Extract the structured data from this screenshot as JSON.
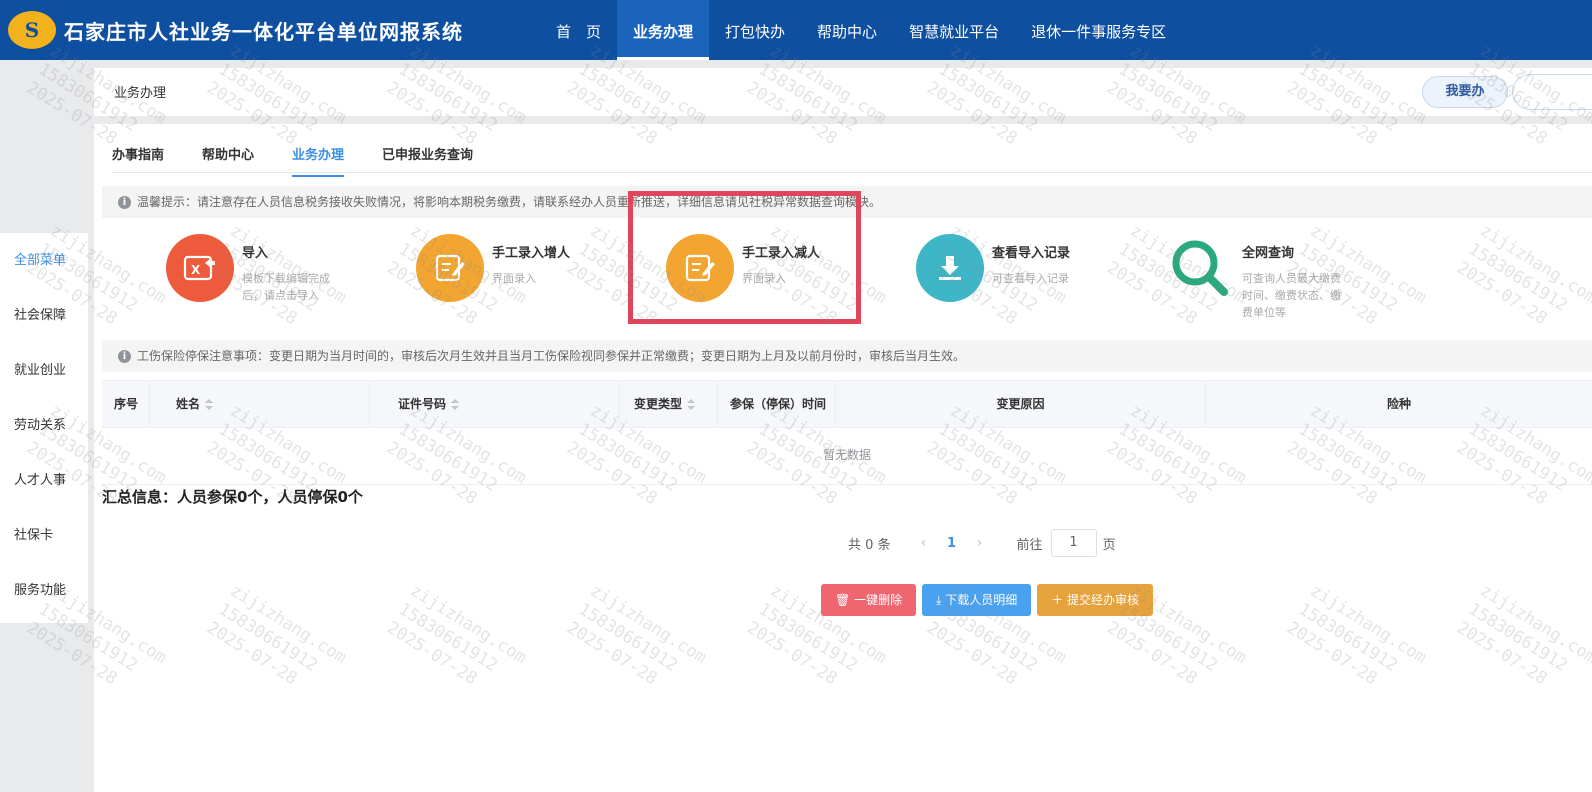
{
  "header": {
    "logo_text": "S",
    "title": "石家庄市人社业务一体化平台单位网报系统",
    "nav": [
      {
        "label": "首　页"
      },
      {
        "label": "业务办理"
      },
      {
        "label": "打包快办"
      },
      {
        "label": "帮助中心"
      },
      {
        "label": "智慧就业平台"
      },
      {
        "label": "退休一件事服务专区"
      }
    ]
  },
  "sidebar": {
    "items": [
      {
        "label": "全部菜单"
      },
      {
        "label": "社会保障"
      },
      {
        "label": "就业创业"
      },
      {
        "label": "劳动关系"
      },
      {
        "label": "人才人事"
      },
      {
        "label": "社保卡"
      },
      {
        "label": "服务功能"
      }
    ]
  },
  "breadcrumb": {
    "label": "业务办理",
    "action_label": "我要办"
  },
  "tabs": [
    {
      "label": "办事指南"
    },
    {
      "label": "帮助中心"
    },
    {
      "label": "业务办理"
    },
    {
      "label": "已申报业务查询"
    }
  ],
  "notice1": "温馨提示：请注意存在人员信息税务接收失败情况，将影响本期税务缴费，请联系经办人员重新推送，详细信息请见社税异常数据查询模块。",
  "functions": [
    {
      "title": "导入",
      "desc": "模板下载编辑完成后，请点击导入",
      "color": "#ee5a3c"
    },
    {
      "title": "手工录入增人",
      "desc": "界面录入",
      "color": "#f3a531"
    },
    {
      "title": "手工录入减人",
      "desc": "界面录入",
      "color": "#f3a531"
    },
    {
      "title": "查看导入记录",
      "desc": "可查看导入记录",
      "color": "#3db6c8"
    },
    {
      "title": "全网查询",
      "desc": "可查询人员最大缴费时间、缴费状态、缴费单位等",
      "color": "#2aa880"
    }
  ],
  "notice2": "工伤保险停保注意事项：变更日期为当月时间的，审核后次月生效并且当月工伤保险视同参保并正常缴费；变更日期为上月及以前月份时，审核后当月生效。",
  "table": {
    "columns": [
      "序号",
      "姓名",
      "证件号码",
      "变更类型",
      "参保（停保）时间",
      "变更原因",
      "险种"
    ],
    "empty_text": "暂无数据"
  },
  "summary": "汇总信息：人员参保0个，人员停保0个",
  "pagination": {
    "total": "共 0 条",
    "current": "1",
    "goto_label": "前往",
    "page_input": "1",
    "unit": "页"
  },
  "actions": [
    {
      "label": "一键删除",
      "icon": "trash-icon",
      "color": "#f06670"
    },
    {
      "label": "下载人员明细",
      "icon": "download-icon",
      "color": "#4aa1f0"
    },
    {
      "label": "提交经办审核",
      "icon": "plus-icon",
      "color": "#e6a23c"
    }
  ],
  "watermark": {
    "line1": "zijizhang.com",
    "line2": "15830661912",
    "line3": "2025-07-28"
  }
}
